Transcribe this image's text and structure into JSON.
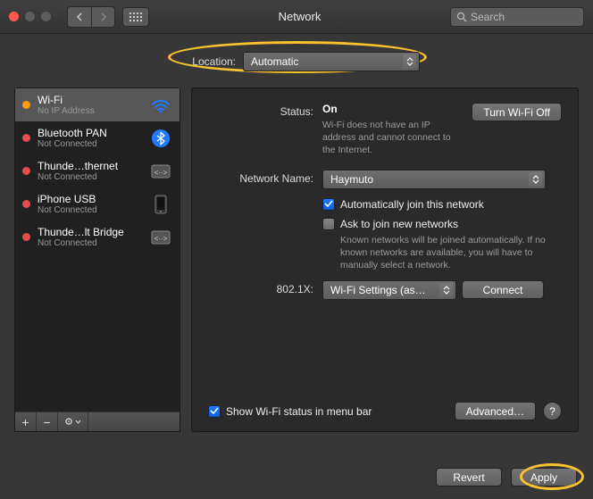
{
  "window": {
    "title": "Network"
  },
  "search": {
    "placeholder": "Search"
  },
  "location": {
    "label": "Location:",
    "value": "Automatic"
  },
  "sidebar": {
    "items": [
      {
        "name": "Wi-Fi",
        "sub": "No IP Address",
        "status": "orange",
        "icon": "wifi"
      },
      {
        "name": "Bluetooth PAN",
        "sub": "Not Connected",
        "status": "red",
        "icon": "bluetooth"
      },
      {
        "name": "Thunde…thernet",
        "sub": "Not Connected",
        "status": "red",
        "icon": "ethernet"
      },
      {
        "name": "iPhone USB",
        "sub": "Not Connected",
        "status": "red",
        "icon": "iphone"
      },
      {
        "name": "Thunde…lt Bridge",
        "sub": "Not Connected",
        "status": "red",
        "icon": "ethernet"
      }
    ],
    "footer": {
      "add": "+",
      "remove": "−",
      "gear": "⚙︎"
    }
  },
  "detail": {
    "status_label": "Status:",
    "status_value": "On",
    "toggle_label": "Turn Wi-Fi Off",
    "status_note": "Wi-Fi does not have an IP address and cannot connect to the Internet.",
    "network_label": "Network Name:",
    "network_value": "Haymuto",
    "auto_join": "Automatically join this network",
    "ask_join": "Ask to join new networks",
    "ask_note": "Known networks will be joined automatically. If no known networks are available, you will have to manually select a network.",
    "dot1x_label": "802.1X:",
    "dot1x_value": "Wi-Fi Settings (as…",
    "connect": "Connect",
    "menubar": "Show Wi-Fi status in menu bar",
    "advanced": "Advanced…",
    "help": "?"
  },
  "buttons": {
    "revert": "Revert",
    "apply": "Apply"
  }
}
